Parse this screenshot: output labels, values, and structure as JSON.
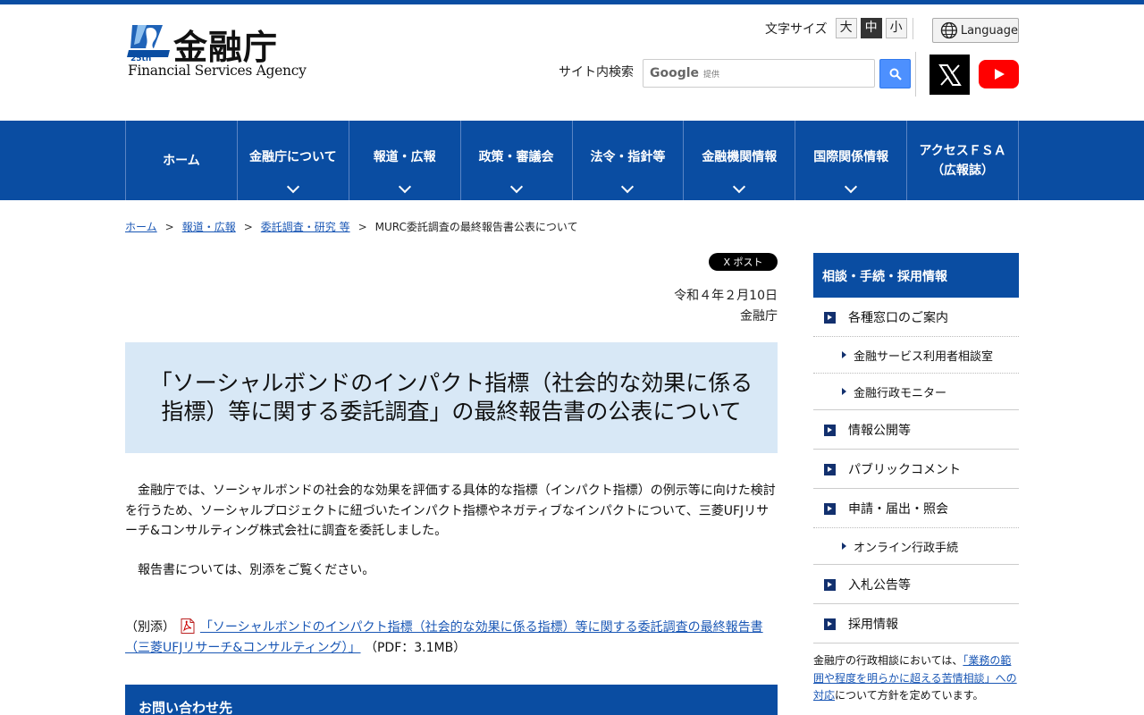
{
  "header": {
    "logo_jp": "金融庁",
    "logo_en": "Financial Services Agency",
    "logo_badge": "25th",
    "font_size": {
      "label": "文字サイズ",
      "options": [
        "大",
        "中",
        "小"
      ],
      "active": "中"
    },
    "language_label": "Language",
    "search": {
      "label": "サイト内検索",
      "google_word": "Google",
      "google_sub": "提供"
    }
  },
  "nav": {
    "items": [
      {
        "label": "ホーム",
        "chevron": false
      },
      {
        "label": "金融庁について",
        "chevron": true
      },
      {
        "label": "報道・広報",
        "chevron": true
      },
      {
        "label": "政策・審議会",
        "chevron": true
      },
      {
        "label": "法令・指針等",
        "chevron": true
      },
      {
        "label": "金融機関情報",
        "chevron": true
      },
      {
        "label": "国際関係情報",
        "chevron": true
      },
      {
        "label": "アクセスＦＳＡ",
        "label2": "（広報誌）",
        "chevron": false
      }
    ]
  },
  "breadcrumb": {
    "items": [
      "ホーム",
      "報道・広報",
      "委託調査・研究 等"
    ],
    "current": "MURC委託調査の最終報告書公表について"
  },
  "main": {
    "x_post_label": "X ポスト",
    "date": "令和４年２月10日",
    "org": "金融庁",
    "title": "「ソーシャルボンドのインパクト指標（社会的な効果に係る指標）等に関する委託調査」の最終報告書の公表について",
    "para1": "　金融庁では、ソーシャルボンドの社会的な効果を評価する具体的な指標（インパクト指標）の例示等に向けた検討を行うため、ソーシャルプロジェクトに紐づいたインパクト指標やネガティブなインパクトについて、三菱UFJリサーチ&コンサルティング株式会社に調査を委託しました。",
    "para2": "　報告書については、別添をご覧ください。",
    "attachment_prefix": "（別添）",
    "attachment_link": "「ソーシャルボンドのインパクト指標（社会的な効果に係る指標）等に関する委託調査の最終報告書（三菱UFJリサーチ&コンサルティング）」",
    "attachment_suffix": "（PDF：3.1MB）",
    "contact_heading": "お問い合わせ先"
  },
  "sidebar": {
    "heading": "相談・手続・採用情報",
    "items": [
      {
        "label": "各種窓口のご案内",
        "type": "main",
        "dotted": true
      },
      {
        "label": "金融サービス利用者相談室",
        "type": "sub"
      },
      {
        "label": "金融行政モニター",
        "type": "sub",
        "last": true
      },
      {
        "label": "情報公開等",
        "type": "main"
      },
      {
        "label": "パブリックコメント",
        "type": "main"
      },
      {
        "label": "申請・届出・照会",
        "type": "main",
        "dotted": true
      },
      {
        "label": "オンライン行政手続",
        "type": "sub",
        "last": true
      },
      {
        "label": "入札公告等",
        "type": "main"
      },
      {
        "label": "採用情報",
        "type": "main"
      }
    ],
    "note_prefix": "金融庁の行政相談においては、",
    "note_link": "「業務の範囲や程度を明らかに超える苦情相談」への対応",
    "note_suffix": "について方針を定めています。"
  },
  "colors": {
    "brand_blue": "#0a4da2",
    "title_bg": "#d8e8f6",
    "link": "#1a57b5"
  }
}
